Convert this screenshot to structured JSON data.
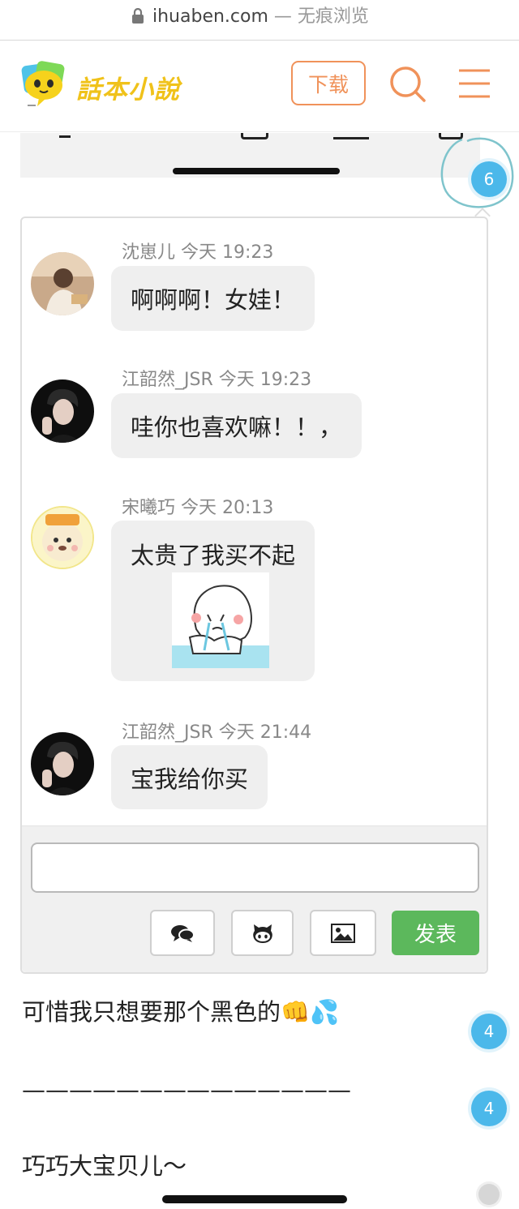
{
  "browser": {
    "url": "ihuaben.com",
    "mode": " — 无痕浏览"
  },
  "header": {
    "logo_text": "話本小說",
    "download_label": "下载",
    "accent_color": "#f0925a"
  },
  "top_comment_count": "6",
  "comments": [
    {
      "user": "沈崽儿",
      "time": "今天 19:23",
      "text": "啊啊啊！女娃！"
    },
    {
      "user": "江韶然_JSR",
      "time": "今天 19:23",
      "text": "哇你也喜欢嘛！！，"
    },
    {
      "user": "宋曦巧",
      "time": "今天 20:13",
      "text": "太贵了我买不起",
      "sticker": "crying-sticker"
    },
    {
      "user": "江韶然_JSR",
      "time": "今天 21:44",
      "text": "宝我给你买"
    }
  ],
  "composer": {
    "input_value": "",
    "post_label": "发表",
    "post_color": "#5cb85c"
  },
  "paragraphs": [
    {
      "text": "可惜我只想要那个黑色的👊💦",
      "count": "4"
    },
    {
      "text": "——————————————",
      "count": "4"
    },
    {
      "text": "巧巧大宝贝儿～"
    }
  ]
}
